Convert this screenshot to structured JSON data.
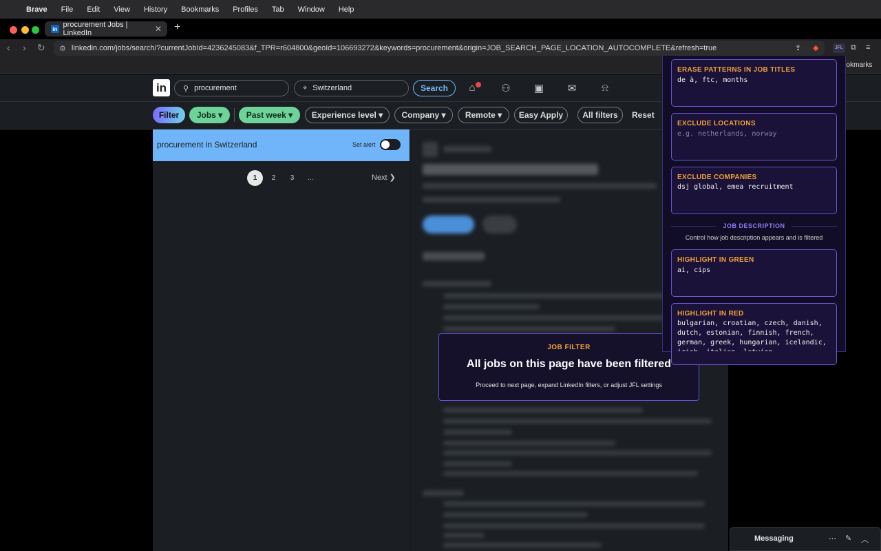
{
  "menubar": {
    "app": "Brave",
    "items": [
      "File",
      "Edit",
      "View",
      "History",
      "Bookmarks",
      "Profiles",
      "Tab",
      "Window",
      "Help"
    ]
  },
  "browser": {
    "tab_title": "procurement Jobs | LinkedIn",
    "tab_favicon": "in",
    "url": "linkedin.com/jobs/search/?currentJobId=4236245083&f_TPR=r604800&geoId=106693272&keywords=procurement&origin=JOB_SEARCH_PAGE_LOCATION_AUTOCOMPLETE&refresh=true",
    "bookmarks_label": "ookmarks",
    "extension_label": "JFL"
  },
  "linkedin": {
    "logo": "in",
    "search_value": "procurement",
    "location_value": "Switzerland",
    "search_button": "Search",
    "filters": {
      "filter": "Filter",
      "jobs": "Jobs",
      "past_week": "Past week",
      "experience": "Experience level",
      "company": "Company",
      "remote": "Remote",
      "easy_apply": "Easy Apply",
      "all_filters": "All filters",
      "reset": "Reset"
    },
    "alert": {
      "title": "procurement in Switzerland",
      "set_alert": "Set alert"
    },
    "pagination": {
      "pages": [
        "1",
        "2",
        "3",
        "…"
      ],
      "next": "Next"
    }
  },
  "jfl_overlay": {
    "kicker": "JOB FILTER",
    "title": "All jobs on this page have been filtered",
    "subtitle": "Proceed to next page, expand LinkedIn filters, or adjust JFL settings"
  },
  "popup": {
    "erase_label": "ERASE PATTERNS IN JOB TITLES",
    "erase_value": "de à, ftc, months",
    "locations_label": "EXCLUDE LOCATIONS",
    "locations_placeholder": "e.g. netherlands, norway",
    "companies_label": "EXCLUDE COMPANIES",
    "companies_value": "dsj global, emea recruitment",
    "jd_heading": "JOB DESCRIPTION",
    "jd_sub": "Control how job description appears and is filtered",
    "green_label": "HIGHLIGHT IN GREEN",
    "green_value": "ai, cips",
    "red_label": "HIGHLIGHT IN RED",
    "red_value": "bulgarian, croatian, czech, danish, dutch, estonian, finnish, french, german, greek, hungarian, icelandic, irish, italian, latvian"
  },
  "messaging": {
    "label": "Messaging"
  },
  "colors": {
    "accent_blue": "#70b5f9",
    "pill_green": "#6ed398",
    "jfl_orange": "#f1a33a",
    "jfl_purple": "#6a55d4"
  }
}
